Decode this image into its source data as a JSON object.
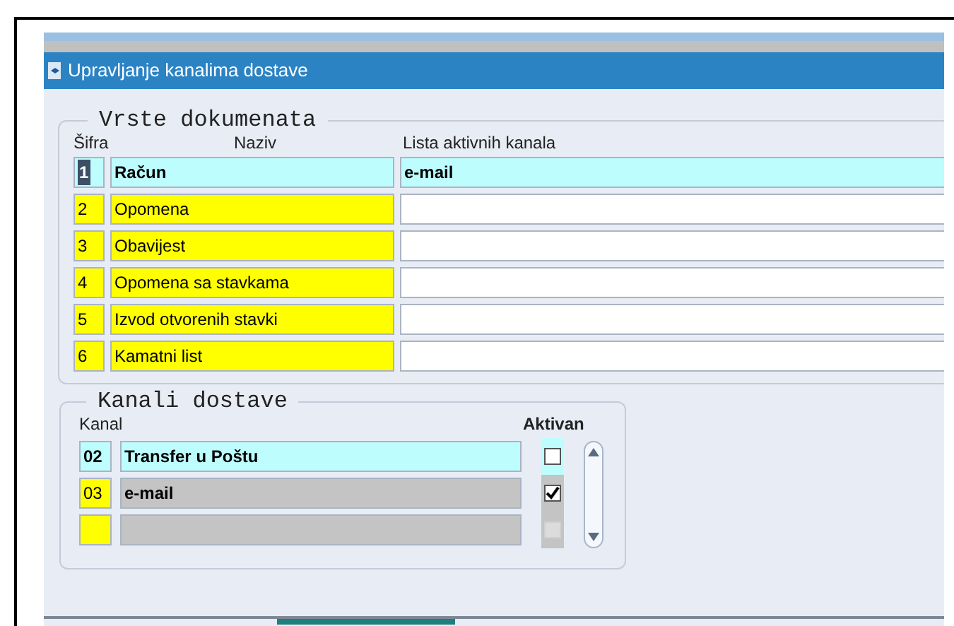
{
  "window": {
    "title": "Upravljanje kanalima dostave"
  },
  "documents": {
    "title": "Vrste dokumenata",
    "columns": [
      "Šifra",
      "Naziv",
      "Lista aktivnih kanala"
    ],
    "rows": [
      {
        "code": "1",
        "name": "Račun",
        "channels": "e-mail",
        "selected": true
      },
      {
        "code": "2",
        "name": "Opomena",
        "selected": false
      },
      {
        "code": "3",
        "name": "Obavijest",
        "selected": false
      },
      {
        "code": "4",
        "name": "Opomena sa stavkama",
        "selected": false
      },
      {
        "code": "5",
        "name": "Izvod otvorenih stavki",
        "selected": false
      },
      {
        "code": "6",
        "name": "Kamatni list",
        "selected": false
      }
    ]
  },
  "channels": {
    "title": "Kanali dostave",
    "columns": [
      "Kanal",
      "Aktivan"
    ],
    "rows": [
      {
        "code": "02",
        "name": "Transfer u Poštu",
        "selected": true,
        "checked": false,
        "disabled": false
      },
      {
        "code": "03",
        "name": "e-mail",
        "selected": false,
        "checked": true,
        "disabled": false
      },
      {
        "selected": false,
        "checked": false,
        "disabled": true
      }
    ]
  }
}
